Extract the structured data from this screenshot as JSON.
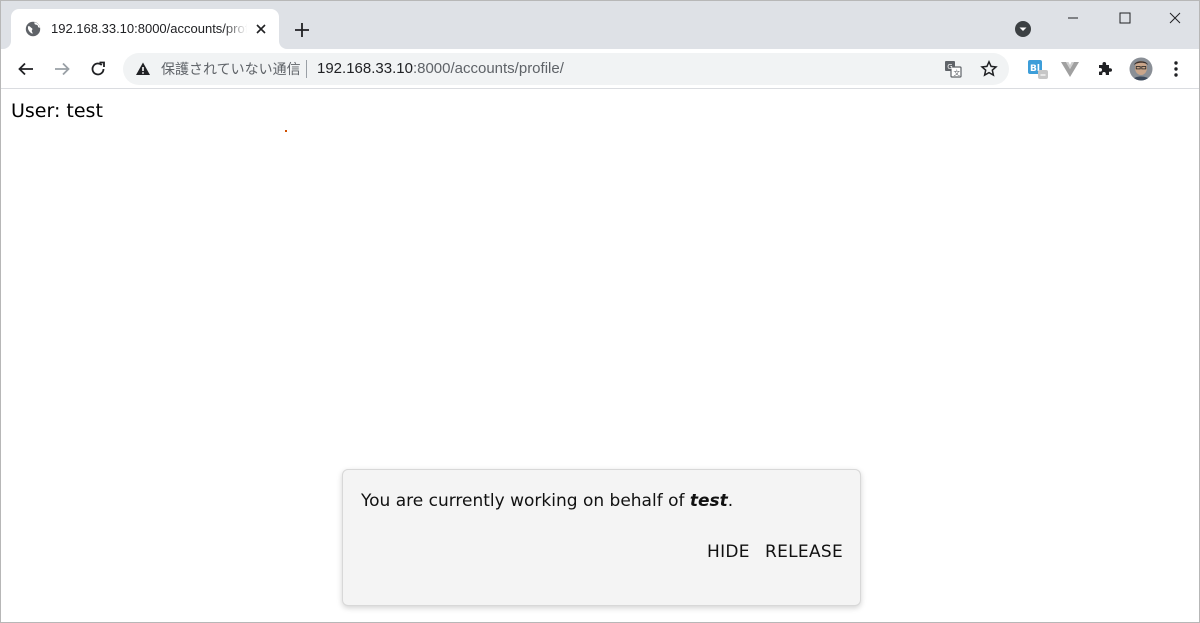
{
  "browser": {
    "tab": {
      "title": "192.168.33.10:8000/accounts/profile/",
      "favicon": "globe-icon"
    },
    "new_tab_label": "+",
    "address_bar": {
      "security_label": "保護されていない通信",
      "url_host": "192.168.33.10",
      "url_rest": ":8000/accounts/profile/"
    },
    "extensions": [
      "translate-icon",
      "bookmark-star-icon",
      "bitly-extension-icon",
      "vue-devtools-icon",
      "extensions-puzzle-icon",
      "profile-avatar",
      "menu-kebab-icon"
    ]
  },
  "page": {
    "user_label": "User:",
    "user_value": "test"
  },
  "banner": {
    "message_prefix": "You are currently working on behalf of",
    "impersonated_user": "test",
    "message_suffix": ".",
    "hide_label": "HIDE",
    "release_label": "RELEASE"
  },
  "colors": {
    "tabstrip": "#dee1e6",
    "omnibox": "#f1f3f4",
    "banner_bg": "#f4f4f4",
    "bitly_blue": "#3d9ed9"
  }
}
